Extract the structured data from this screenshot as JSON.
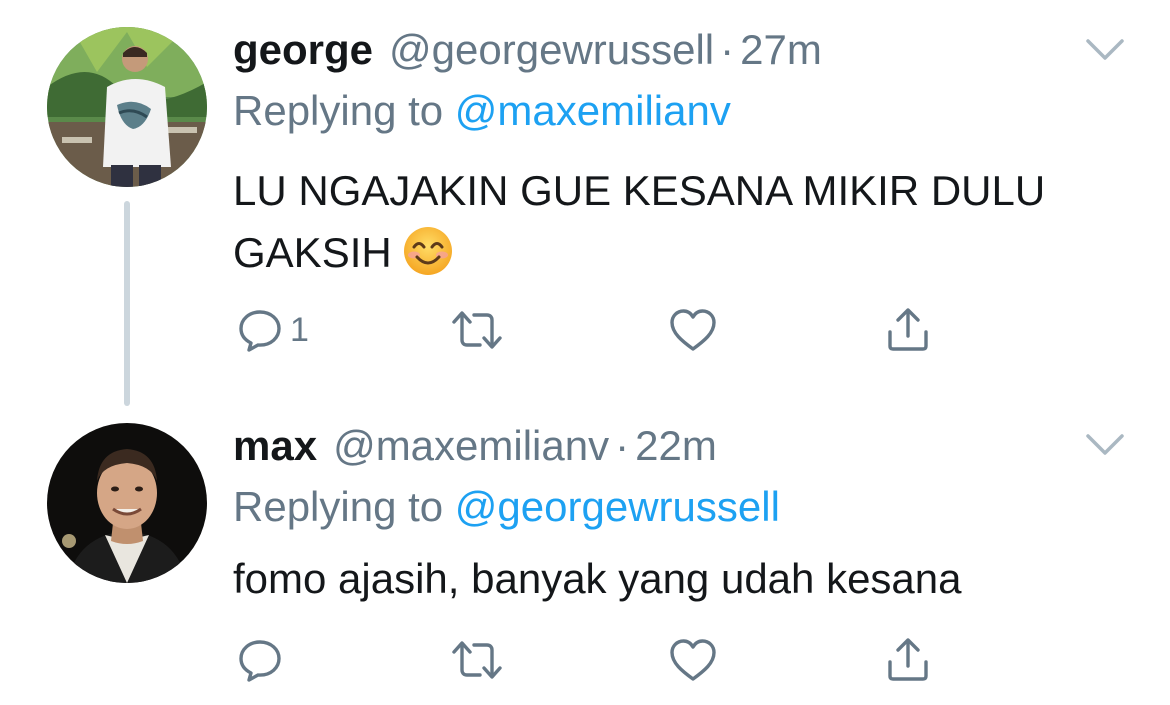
{
  "tweets": [
    {
      "name": "george",
      "handle": "@georgewrussell",
      "separator": "·",
      "time": "27m",
      "replying_prefix": "Replying to ",
      "replying_to": "@maxemilianv",
      "text": "LU NGAJAKIN GUE KESANA MIKIR DULU GAKSIH",
      "emoji": "smiling-face-with-smiling-eyes",
      "reply_count": "1",
      "retweet_count": "",
      "like_count": ""
    },
    {
      "name": "max",
      "handle": "@maxemilianv",
      "separator": "·",
      "time": "22m",
      "replying_prefix": "Replying to ",
      "replying_to": "@georgewrussell",
      "text": "fomo ajasih, banyak yang udah kesana",
      "reply_count": "",
      "retweet_count": "",
      "like_count": ""
    }
  ],
  "colors": {
    "text_primary": "#14171a",
    "text_secondary": "#657786",
    "link": "#1da1f2",
    "thread_line": "#ccd6dd",
    "icon": "#657786"
  },
  "icons": {
    "menu": "chevron-down-icon",
    "reply": "reply-bubble-icon",
    "retweet": "retweet-icon",
    "like": "heart-icon",
    "share": "share-icon"
  }
}
